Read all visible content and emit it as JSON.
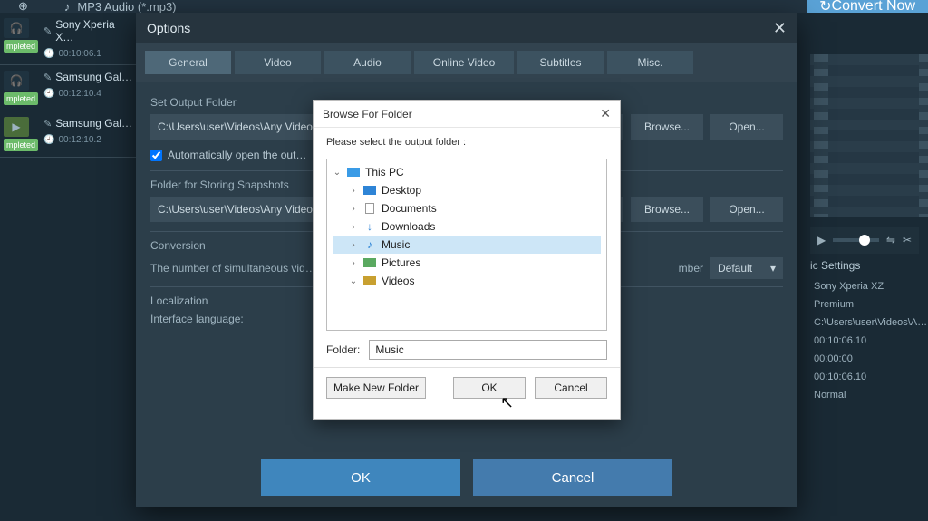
{
  "topbar": {
    "convert_label": "Convert Now",
    "format_label": "MP3 Audio (*.mp3)"
  },
  "files": [
    {
      "name": "Sony Xperia X…",
      "time": "00:10:06.1",
      "status": "mpleted"
    },
    {
      "name": "Samsung Gal…",
      "time": "00:12:10.4",
      "status": "mpleted"
    },
    {
      "name": "Samsung Gal…",
      "time": "00:12:10.2",
      "status": "mpleted"
    }
  ],
  "right": {
    "settings_hdr": "ic Settings",
    "lines": [
      "Sony Xperia XZ Premium",
      "C:\\Users\\user\\Videos\\A…",
      "00:10:06.10",
      "00:00:00",
      "00:10:06.10",
      "Normal"
    ]
  },
  "options": {
    "title": "Options",
    "tabs": [
      "General",
      "Video",
      "Audio",
      "Online Video",
      "Subtitles",
      "Misc."
    ],
    "set_output_label": "Set Output Folder",
    "output_path": "C:\\Users\\user\\Videos\\Any Video…",
    "browse_label": "Browse...",
    "open_label": "Open...",
    "auto_open_label": "Automatically open the out…",
    "snapshot_label": "Folder for Storing Snapshots",
    "snapshot_path": "C:\\Users\\user\\Videos\\Any Video…",
    "conversion_label": "Conversion",
    "conversion_text": "The number of simultaneous vid…",
    "number_label": "mber",
    "number_value": "Default",
    "localization_label": "Localization",
    "lang_label": "Interface language:",
    "ok_label": "OK",
    "cancel_label": "Cancel"
  },
  "browse": {
    "title": "Browse For Folder",
    "subtitle": "Please select the output folder :",
    "tree": {
      "root": "This PC",
      "items": [
        "Desktop",
        "Documents",
        "Downloads",
        "Music",
        "Pictures",
        "Videos"
      ]
    },
    "folder_label": "Folder:",
    "folder_value": "Music",
    "make_new": "Make New Folder",
    "ok": "OK",
    "cancel": "Cancel"
  }
}
